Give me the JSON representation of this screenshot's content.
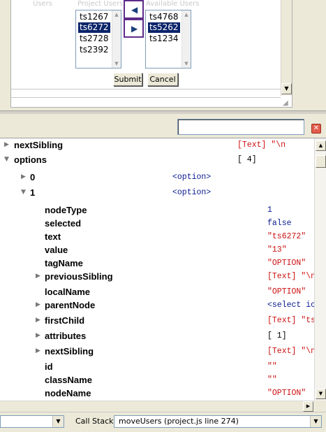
{
  "form": {
    "users_label": "Users",
    "project_users_label": "Project Users",
    "available_users_label": "Available Users",
    "project_users": [
      {
        "text": "ts1267",
        "selected": false
      },
      {
        "text": "ts6272",
        "selected": true
      },
      {
        "text": "ts2728",
        "selected": false
      },
      {
        "text": "ts2392",
        "selected": false
      }
    ],
    "available_users": [
      {
        "text": "ts4768",
        "selected": false
      },
      {
        "text": "ts5262",
        "selected": true
      },
      {
        "text": "ts1234",
        "selected": false
      }
    ],
    "move_left_icon": "triangle-left-icon",
    "move_right_icon": "triangle-right-icon",
    "submit_label": "Submit",
    "cancel_label": "Cancel"
  },
  "toolbar": {
    "search_value": "",
    "close_icon": "close-icon",
    "close_glyph": "✕"
  },
  "inspector": {
    "rows": [
      {
        "name": "nextSibling",
        "value": "[Text] \"\\n",
        "color": "red",
        "twisty": "collapsed",
        "level": 0
      },
      {
        "name": "options",
        "value": "[ 4]",
        "color": "black",
        "twisty": "expanded",
        "level": 0
      },
      {
        "name": "0",
        "value": "<option>",
        "color": "blue",
        "twisty": "collapsed",
        "level": 1
      },
      {
        "name": "1",
        "value": "<option>",
        "color": "blue",
        "twisty": "expanded",
        "level": 1
      },
      {
        "name": "nodeType",
        "value": "1",
        "color": "blue",
        "twisty": "none",
        "level": 2
      },
      {
        "name": "selected",
        "value": "false",
        "color": "blue",
        "twisty": "none",
        "level": 2
      },
      {
        "name": "text",
        "value": "\"ts6272\"",
        "color": "red",
        "twisty": "none",
        "level": 2
      },
      {
        "name": "value",
        "value": "\"13\"",
        "color": "red",
        "twisty": "none",
        "level": 2
      },
      {
        "name": "tagName",
        "value": "\"OPTION\"",
        "color": "red",
        "twisty": "none",
        "level": 2
      },
      {
        "name": "previousSibling",
        "value": "[Text] \"\\n",
        "color": "red",
        "twisty": "collapsed",
        "level": 2
      },
      {
        "name": "localName",
        "value": "\"OPTION\"",
        "color": "red",
        "twisty": "none",
        "level": 2
      },
      {
        "name": "parentNode",
        "value": "<select ic",
        "color": "blue",
        "twisty": "collapsed",
        "level": 2
      },
      {
        "name": "firstChild",
        "value": "[Text] \"ts",
        "color": "red",
        "twisty": "collapsed",
        "level": 2
      },
      {
        "name": "attributes",
        "value": "[ 1]",
        "color": "black",
        "twisty": "collapsed",
        "level": 2
      },
      {
        "name": "nextSibling",
        "value": "[Text] \"\\n",
        "color": "red",
        "twisty": "collapsed",
        "level": 2
      },
      {
        "name": "id",
        "value": "\"\"",
        "color": "red",
        "twisty": "none",
        "level": 2
      },
      {
        "name": "className",
        "value": "\"\"",
        "color": "red",
        "twisty": "none",
        "level": 2
      },
      {
        "name": "nodeName",
        "value": "\"OPTION\"",
        "color": "red",
        "twisty": "none",
        "level": 2
      }
    ]
  },
  "statusbar": {
    "left_dropdown_value": "",
    "callstack_label": "Call Stack:",
    "callstack_value": "moveUsers (project.js line 274)"
  }
}
